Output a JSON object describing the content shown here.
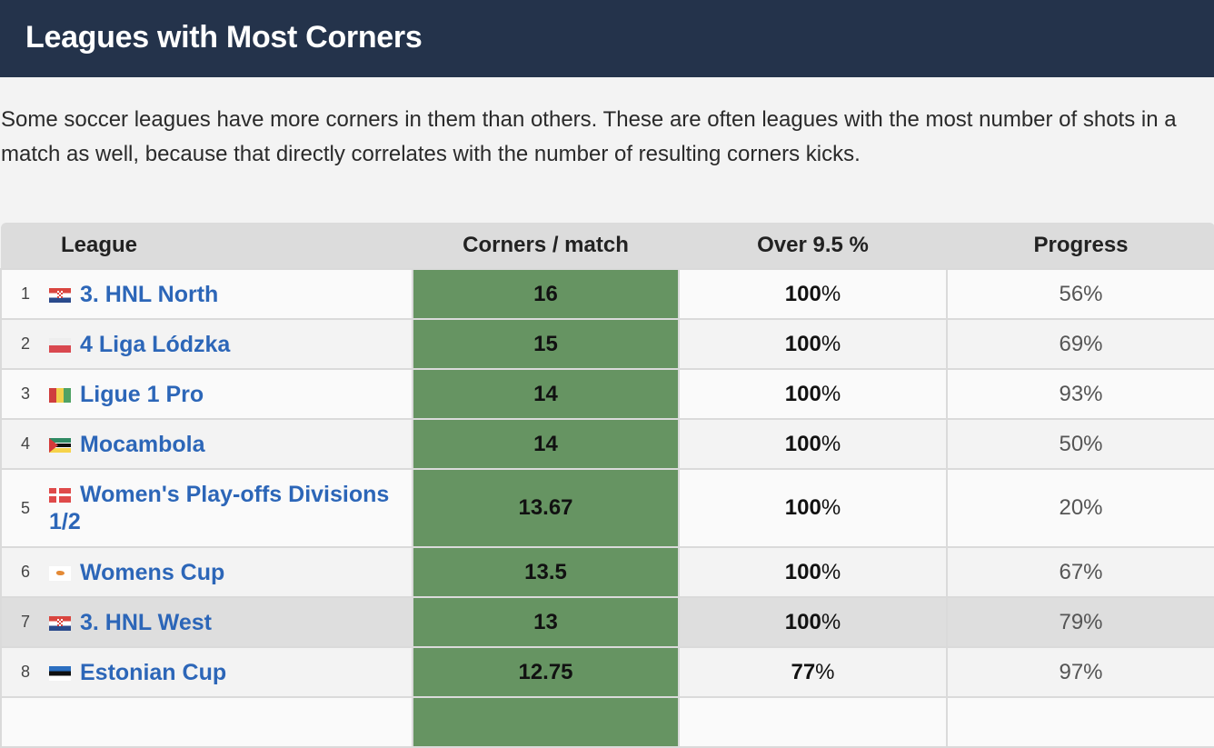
{
  "header": {
    "title": "Leagues with Most Corners"
  },
  "intro": "Some soccer leagues have more corners in them than others. These are often leagues with the most number of shots in a match as well, because that directly correlates with the number of resulting corners kicks.",
  "table": {
    "columns": [
      "League",
      "Corners / match",
      "Over 9.5 %",
      "Progress"
    ],
    "accent_color": "#669462",
    "rows": [
      {
        "rank": "1",
        "flag": "croatia-flag-icon",
        "league": "3. HNL North",
        "corners": "16",
        "over": "100",
        "progress": "56%"
      },
      {
        "rank": "2",
        "flag": "poland-flag-icon",
        "league": "4 Liga Lódzka",
        "corners": "15",
        "over": "100",
        "progress": "69%"
      },
      {
        "rank": "3",
        "flag": "guinea-flag-icon",
        "league": "Ligue 1 Pro",
        "corners": "14",
        "over": "100",
        "progress": "93%"
      },
      {
        "rank": "4",
        "flag": "mozambique-flag-icon",
        "league": "Mocambola",
        "corners": "14",
        "over": "100",
        "progress": "50%"
      },
      {
        "rank": "5",
        "flag": "denmark-flag-icon",
        "league": "Women's Play-offs Divisions 1/2",
        "corners": "13.67",
        "over": "100",
        "progress": "20%"
      },
      {
        "rank": "6",
        "flag": "cyprus-flag-icon",
        "league": "Womens Cup",
        "corners": "13.5",
        "over": "100",
        "progress": "67%"
      },
      {
        "rank": "7",
        "flag": "croatia-flag-icon",
        "league": "3. HNL West",
        "corners": "13",
        "over": "100",
        "progress": "79%"
      },
      {
        "rank": "8",
        "flag": "estonia-flag-icon",
        "league": "Estonian Cup",
        "corners": "12.75",
        "over": "77",
        "progress": "97%"
      }
    ],
    "percent_sign": "%"
  }
}
